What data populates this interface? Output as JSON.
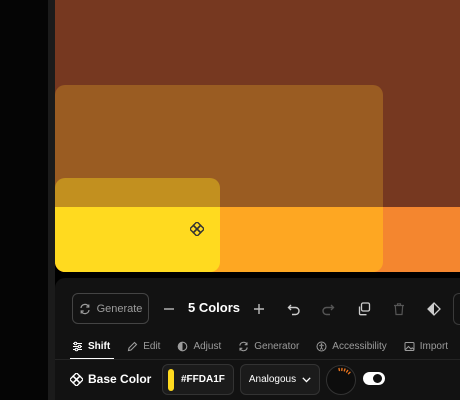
{
  "toolbar": {
    "generate_label": "Generate",
    "color_count": "5 Colors"
  },
  "tabs": [
    {
      "label": "Shift",
      "icon": "sliders-icon",
      "active": true
    },
    {
      "label": "Edit",
      "icon": "pencil-icon",
      "active": false
    },
    {
      "label": "Adjust",
      "icon": "contrast-icon",
      "active": false
    },
    {
      "label": "Generator",
      "icon": "refresh-icon",
      "active": false
    },
    {
      "label": "Accessibility",
      "icon": "accessibility-icon",
      "active": false
    },
    {
      "label": "Import",
      "icon": "image-icon",
      "active": false
    }
  ],
  "base_color": {
    "label": "Base Color",
    "hex": "#FFDA1F",
    "mode": "Analogous"
  },
  "palette": {
    "colors": [
      "#FFDA1F",
      "#9A5C22",
      "#C2901F",
      "#FEA722",
      "#F4862F"
    ],
    "background": "#763820"
  }
}
